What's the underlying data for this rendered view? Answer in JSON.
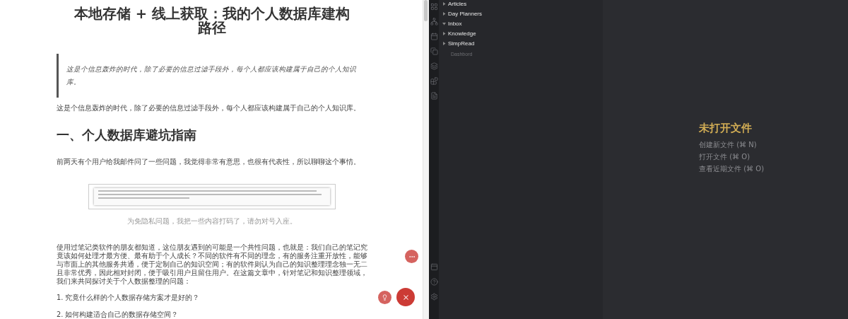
{
  "article": {
    "title": "本地存储 + 线上获取：我的个人数据库建构路径",
    "quote": "这是个信息轰炸的时代，除了必要的信息过滤手段外，每个人都应该构建属于自己的个人知识库。",
    "blocks": [
      {
        "kind": "paragraph",
        "text": "这是个信息轰炸的时代，除了必要的信息过滤手段外，每个人都应该构建属于自己的个人知识库。"
      },
      {
        "kind": "heading",
        "text": "一、个人数据库避坑指南"
      },
      {
        "kind": "paragraph",
        "text": "前两天有个用户给我邮件问了一些问题，我觉得非常有意思，也很有代表性，所以聊聊这个事情。"
      },
      {
        "kind": "image",
        "text": "为免隐私问题，我把一些内容打码了，请勿对号入座。"
      },
      {
        "kind": "body",
        "text": "使用过笔记类软件的朋友都知道，这位朋友遇到的可能是一个共性问题，也就是：我们自己的笔记究竟该如何处理才最方便、最有助于个人成长？不同的软件有不同的理念，有的服务注重开放性，能够与市面上的其他服务共通，便于定制自己的知识空间；有的软件则认为自己的知识整理理念独一无二且非常优秀，因此相对封闭，便于吸引用户且留住用户。在这篇文章中，针对笔记和知识整理领域，我们来共同探讨关于个人数据整理的问题："
      },
      {
        "kind": "body",
        "text": "1. 究竟什么样的个人数据存储方案才是好的？"
      },
      {
        "kind": "body",
        "text": "2. 如何构建适合自己的数据存储空间？"
      }
    ]
  },
  "fab": [
    {
      "kind": "more"
    },
    {
      "kind": "idea"
    },
    {
      "kind": "close"
    }
  ],
  "ribbon": {
    "top": [
      {
        "kind": "grid"
      },
      {
        "kind": "graph"
      },
      {
        "kind": "calendar"
      },
      {
        "kind": "copy"
      },
      {
        "kind": "stack"
      },
      {
        "kind": "blocks"
      },
      {
        "kind": "document"
      }
    ],
    "bottom": [
      {
        "kind": "panel"
      },
      {
        "kind": "help"
      },
      {
        "kind": "settings"
      }
    ]
  },
  "file_tree": [
    {
      "kind": "folder",
      "name": "Articles",
      "expanded": false
    },
    {
      "kind": "folder",
      "name": "Day Planners",
      "expanded": false
    },
    {
      "kind": "folder",
      "name": "Inbox",
      "expanded": true
    },
    {
      "kind": "folder",
      "name": "Knowledge",
      "expanded": false
    },
    {
      "kind": "folder",
      "name": "SimpRead",
      "expanded": false
    },
    {
      "kind": "file",
      "name": "Dashbord"
    }
  ],
  "empty_state": {
    "title": "未打开文件",
    "actions": [
      "创建新文件 (⌘ N)",
      "打开文件 (⌘ O)",
      "查看近期文件 (⌘ O)"
    ]
  }
}
